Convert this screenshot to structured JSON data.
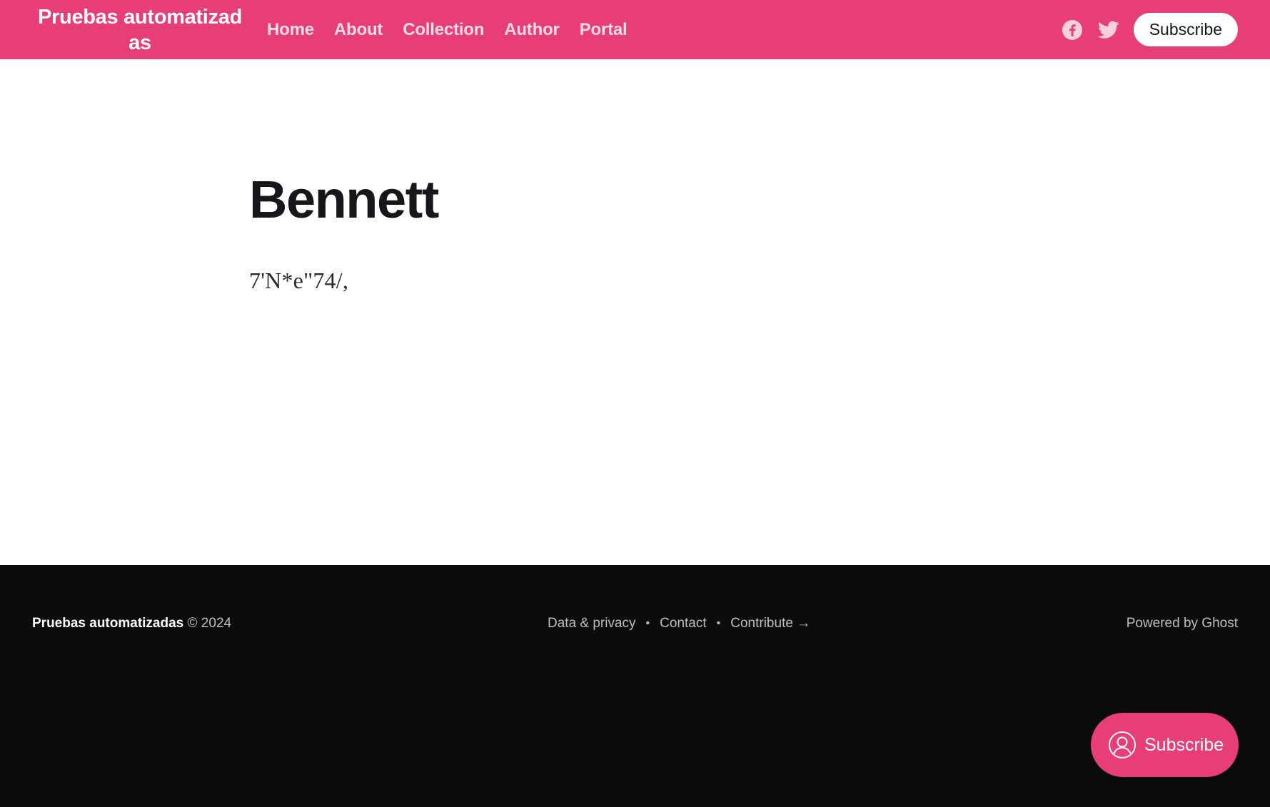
{
  "header": {
    "brand": "Pruebas automatizadas",
    "nav": [
      {
        "label": "Home"
      },
      {
        "label": "About"
      },
      {
        "label": "Collection"
      },
      {
        "label": "Author"
      },
      {
        "label": "Portal"
      }
    ],
    "social": [
      {
        "icon": "facebook-icon"
      },
      {
        "icon": "twitter-icon"
      }
    ],
    "subscribe_label": "Subscribe"
  },
  "author": {
    "name": "Bennett",
    "bio": "7'N*e\"74/,"
  },
  "footer": {
    "brand": "Pruebas automatizadas",
    "copyright": "© 2024",
    "links": [
      {
        "label": "Data & privacy"
      },
      {
        "label": "Contact"
      },
      {
        "label": "Contribute →"
      }
    ],
    "powered_by": "Powered by Ghost"
  },
  "portal": {
    "label": "Subscribe",
    "icon": "user-circle-icon"
  },
  "colors": {
    "accent": "#e83e77",
    "footer_bg": "#0b0c0e",
    "text": "#15171a"
  }
}
